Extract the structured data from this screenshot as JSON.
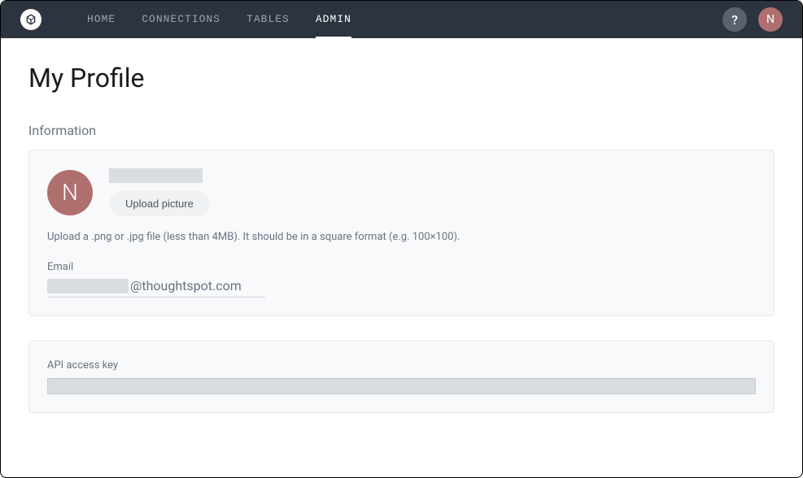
{
  "nav": {
    "items": [
      {
        "label": "HOME",
        "active": false
      },
      {
        "label": "CONNECTIONS",
        "active": false
      },
      {
        "label": "TABLES",
        "active": false
      },
      {
        "label": "ADMIN",
        "active": true
      }
    ]
  },
  "topbar": {
    "help_glyph": "?",
    "avatar_letter": "N"
  },
  "page": {
    "title": "My Profile"
  },
  "information": {
    "section_label": "Information",
    "avatar_letter": "N",
    "upload_button_label": "Upload picture",
    "upload_hint": "Upload a .png or .jpg file (less than 4MB). It should be in a square format (e.g. 100×100).",
    "email_label": "Email",
    "email_domain": "@thoughtspot.com"
  },
  "api": {
    "label": "API access key"
  }
}
